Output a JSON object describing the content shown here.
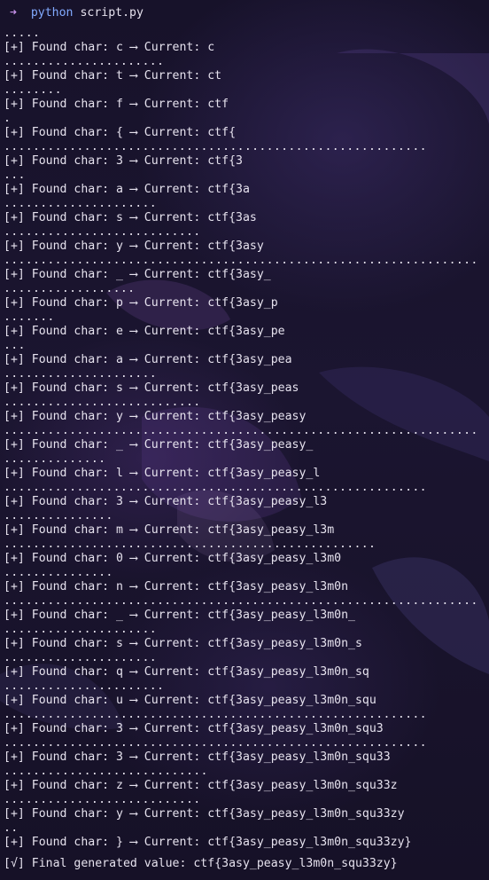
{
  "prompt": {
    "arrow": "➜",
    "command": "python",
    "argument": "script.py"
  },
  "lines": [
    {
      "dots": ".....",
      "found": "[+] Found char: c ⟶ Current: c"
    },
    {
      "dots": "......................",
      "found": "[+] Found char: t ⟶ Current: ct"
    },
    {
      "dots": "........",
      "found": "[+] Found char: f ⟶ Current: ctf"
    },
    {
      "dots": ".",
      "found": "[+] Found char: { ⟶ Current: ctf{"
    },
    {
      "dots": "..........................................................",
      "found": "[+] Found char: 3 ⟶ Current: ctf{3"
    },
    {
      "dots": "...",
      "found": "[+] Found char: a ⟶ Current: ctf{3a"
    },
    {
      "dots": ".....................",
      "found": "[+] Found char: s ⟶ Current: ctf{3as"
    },
    {
      "dots": "...........................",
      "found": "[+] Found char: y ⟶ Current: ctf{3asy"
    },
    {
      "dots": ".................................................................",
      "found": "[+] Found char: _ ⟶ Current: ctf{3asy_"
    },
    {
      "dots": "..................",
      "found": "[+] Found char: p ⟶ Current: ctf{3asy_p"
    },
    {
      "dots": ".......",
      "found": "[+] Found char: e ⟶ Current: ctf{3asy_pe"
    },
    {
      "dots": "...",
      "found": "[+] Found char: a ⟶ Current: ctf{3asy_pea"
    },
    {
      "dots": ".....................",
      "found": "[+] Found char: s ⟶ Current: ctf{3asy_peas"
    },
    {
      "dots": "...........................",
      "found": "[+] Found char: y ⟶ Current: ctf{3asy_peasy"
    },
    {
      "dots": ".................................................................",
      "found": "[+] Found char: _ ⟶ Current: ctf{3asy_peasy_"
    },
    {
      "dots": "..............",
      "found": "[+] Found char: l ⟶ Current: ctf{3asy_peasy_l"
    },
    {
      "dots": "..........................................................",
      "found": "[+] Found char: 3 ⟶ Current: ctf{3asy_peasy_l3"
    },
    {
      "dots": "...............",
      "found": "[+] Found char: m ⟶ Current: ctf{3asy_peasy_l3m"
    },
    {
      "dots": "...................................................",
      "found": "[+] Found char: 0 ⟶ Current: ctf{3asy_peasy_l3m0"
    },
    {
      "dots": "...............",
      "found": "[+] Found char: n ⟶ Current: ctf{3asy_peasy_l3m0n"
    },
    {
      "dots": ".................................................................",
      "found": "[+] Found char: _ ⟶ Current: ctf{3asy_peasy_l3m0n_"
    },
    {
      "dots": ".....................",
      "found": "[+] Found char: s ⟶ Current: ctf{3asy_peasy_l3m0n_s"
    },
    {
      "dots": ".....................",
      "found": "[+] Found char: q ⟶ Current: ctf{3asy_peasy_l3m0n_sq"
    },
    {
      "dots": "......................",
      "found": "[+] Found char: u ⟶ Current: ctf{3asy_peasy_l3m0n_squ"
    },
    {
      "dots": "..........................................................",
      "found": "[+] Found char: 3 ⟶ Current: ctf{3asy_peasy_l3m0n_squ3"
    },
    {
      "dots": "..........................................................",
      "found": "[+] Found char: 3 ⟶ Current: ctf{3asy_peasy_l3m0n_squ33"
    },
    {
      "dots": "............................",
      "found": "[+] Found char: z ⟶ Current: ctf{3asy_peasy_l3m0n_squ33z"
    },
    {
      "dots": "...........................",
      "found": "[+] Found char: y ⟶ Current: ctf{3asy_peasy_l3m0n_squ33zy"
    },
    {
      "dots": "..",
      "found": "[+] Found char: } ⟶ Current: ctf{3asy_peasy_l3m0n_squ33zy}"
    }
  ],
  "final": "[√] Final generated value: ctf{3asy_peasy_l3m0n_squ33zy}",
  "colors": {
    "background": "#140f23",
    "text": "#e6e2ee",
    "prompt_arrow": "#c792ea",
    "command": "#82aaff"
  }
}
